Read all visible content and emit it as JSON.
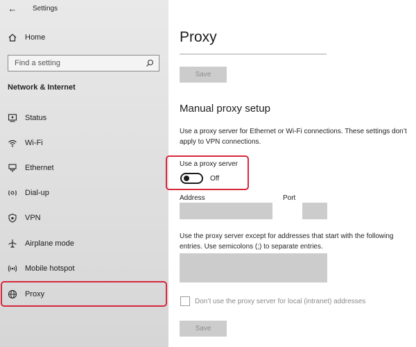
{
  "window": {
    "title": "Settings",
    "back_glyph": "←"
  },
  "sidebar": {
    "home_label": "Home",
    "search": {
      "placeholder": "Find a setting"
    },
    "section_title": "Network & Internet",
    "items": [
      {
        "label": "Status",
        "icon": "status-icon"
      },
      {
        "label": "Wi-Fi",
        "icon": "wifi-icon"
      },
      {
        "label": "Ethernet",
        "icon": "ethernet-icon"
      },
      {
        "label": "Dial-up",
        "icon": "dialup-icon"
      },
      {
        "label": "VPN",
        "icon": "vpn-icon"
      },
      {
        "label": "Airplane mode",
        "icon": "airplane-icon"
      },
      {
        "label": "Mobile hotspot",
        "icon": "hotspot-icon"
      },
      {
        "label": "Proxy",
        "icon": "globe-icon",
        "active": true
      }
    ]
  },
  "main": {
    "title": "Proxy",
    "save_label": "Save",
    "manual_heading": "Manual proxy setup",
    "manual_desc": "Use a proxy server for Ethernet or Wi-Fi connections. These settings don’t apply to VPN connections.",
    "use_proxy": {
      "label": "Use a proxy server",
      "state": "Off",
      "on": false
    },
    "address_label": "Address",
    "port_label": "Port",
    "address_value": "",
    "port_value": "",
    "exceptions_desc": "Use the proxy server except for addresses that start with the following entries. Use semicolons (;) to separate entries.",
    "exceptions_value": "",
    "local_checkbox": {
      "label": "Don’t use the proxy server for local (intranet) addresses",
      "checked": false
    },
    "save_bottom_label": "Save"
  },
  "colors": {
    "highlight": "#d6263b",
    "disabled_fill": "#cccccc",
    "sidebar_bg": "#e2e2e2"
  }
}
